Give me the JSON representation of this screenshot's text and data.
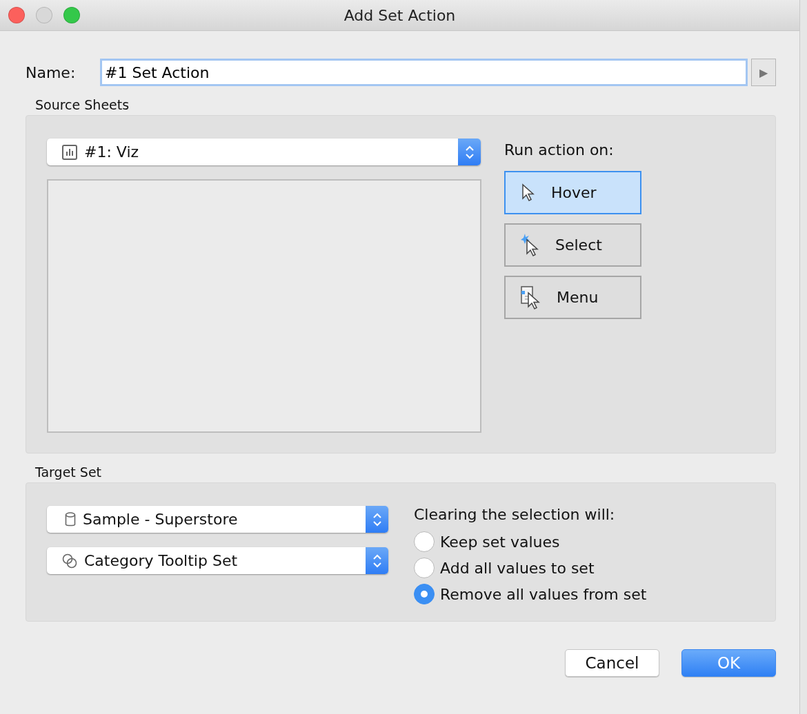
{
  "window": {
    "title": "Add Set Action"
  },
  "name_field": {
    "label": "Name:",
    "value": "#1 Set Action",
    "expand_symbol": "▶"
  },
  "source_sheets": {
    "heading": "Source Sheets",
    "sheet_select": {
      "kind": "sheet",
      "value": "#1: Viz"
    },
    "run_action_label": "Run action on:",
    "run_action_options": [
      {
        "kind": "hover",
        "label": "Hover",
        "selected": true
      },
      {
        "kind": "select",
        "label": "Select",
        "selected": false
      },
      {
        "kind": "menu",
        "label": "Menu",
        "selected": false
      }
    ]
  },
  "target_set": {
    "heading": "Target Set",
    "selects": [
      {
        "kind": "datasource",
        "value": "Sample - Superstore"
      },
      {
        "kind": "set",
        "value": "Category Tooltip Set"
      }
    ],
    "clearing_label": "Clearing the selection will:",
    "clearing_options": [
      {
        "label": "Keep set values",
        "selected": false
      },
      {
        "label": "Add all values to set",
        "selected": false
      },
      {
        "label": "Remove all values from set",
        "selected": true
      }
    ]
  },
  "buttons": [
    {
      "kind": "cancel",
      "label": "Cancel"
    },
    {
      "kind": "ok",
      "label": "OK"
    }
  ]
}
